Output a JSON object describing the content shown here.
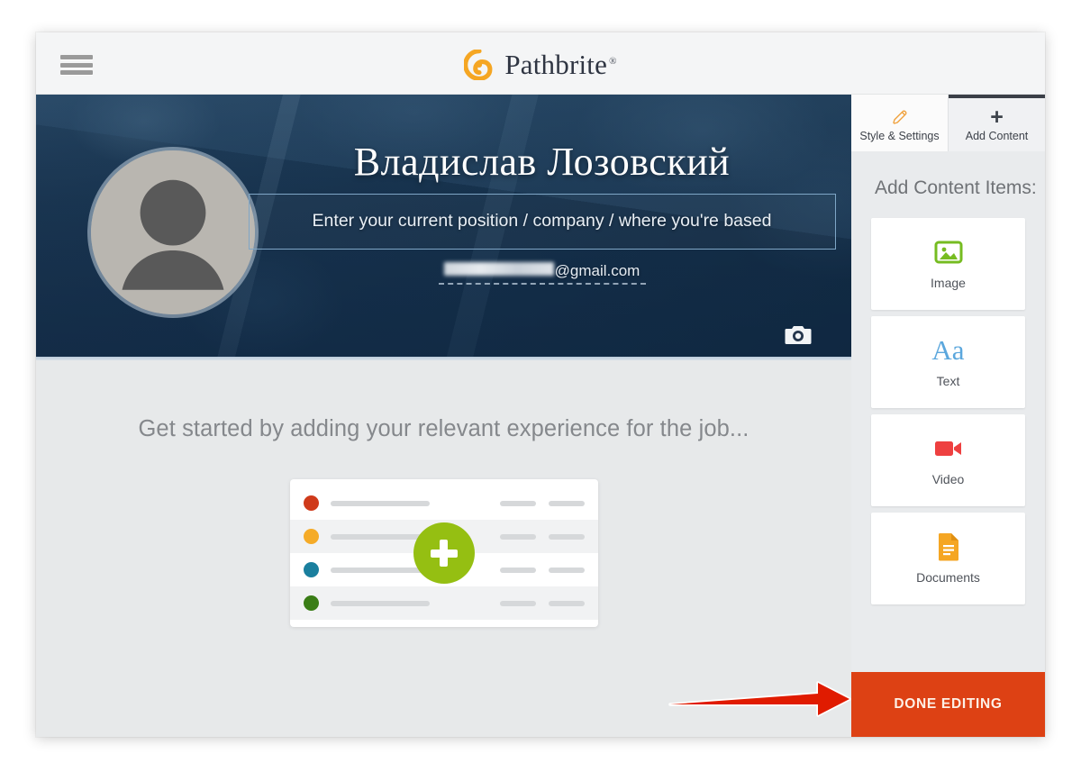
{
  "window": {
    "topbar": {
      "menu_icon": "hamburger-menu-icon",
      "brand_name": "Pathbrite",
      "brand_registered": "®",
      "brand_mark_icon": "pathbrite-logo-icon",
      "brand_color": "#f5a623"
    }
  },
  "cover": {
    "avatar_icon": "default-user-avatar-icon",
    "profile_name": "Владислав Лозовский",
    "headline_placeholder": "Enter your current position / company / where you're based",
    "headline_value": "",
    "email_blurred": "",
    "email_domain": "@gmail.com",
    "camera_icon": "camera-icon",
    "border_color": "#7fa6c6"
  },
  "empty_state": {
    "title": "Get started by adding your relevant experience for the job...",
    "add_button_icon": "plus-icon",
    "add_button_color": "#95bf12",
    "rows": [
      {
        "dot_color": "#cf3a1a"
      },
      {
        "dot_color": "#f5ab28"
      },
      {
        "dot_color": "#1a7f9e"
      },
      {
        "dot_color": "#3a7d16"
      }
    ]
  },
  "sidebar": {
    "tabs": [
      {
        "label": "Style & Settings",
        "icon": "pencil-icon",
        "active": false
      },
      {
        "label": "Add Content",
        "icon": "plus-icon",
        "active": true
      }
    ],
    "heading": "Add Content Items:",
    "items": [
      {
        "label": "Image",
        "icon": "image-icon",
        "color": "#76bc21"
      },
      {
        "label": "Text",
        "icon": "text-aa-icon",
        "glyph": "Aa",
        "color": "#5ba7dd"
      },
      {
        "label": "Video",
        "icon": "video-camera-icon",
        "color": "#ee4040"
      },
      {
        "label": "Documents",
        "icon": "document-icon",
        "color": "#f5a623"
      }
    ],
    "done_button": {
      "label": "DONE EDITING",
      "color": "#dd4114"
    }
  },
  "annotation": {
    "arrow_icon": "red-pointer-arrow-icon",
    "color": "#e01b00"
  }
}
